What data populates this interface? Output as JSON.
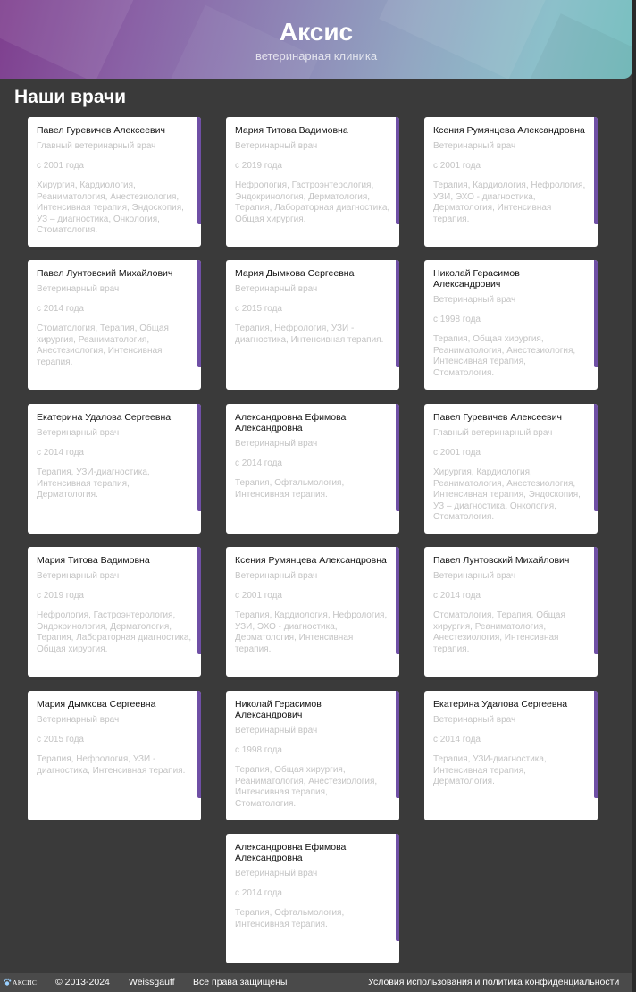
{
  "header": {
    "title": "Аксис",
    "subtitle": "ветеринарная клиника"
  },
  "section_title": "Наши врачи",
  "doctors": [
    {
      "name": "Павел Гуревичев Алексеевич",
      "role": "Главный ветеринарный врач",
      "since": "с 2001 года",
      "specs": "Хирургия, Кардиология, Реаниматология, Анестезиология, Интенсивная терапия, Эндоскопия, УЗ – диагностика, Онкология, Стоматология."
    },
    {
      "name": "Мария Титова Вадимовна",
      "role": "Ветеринарный врач",
      "since": "с 2019 года",
      "specs": "Нефрология, Гастроэнтерология, Эндокринология, Дерматология, Терапия, Лабораторная диагностика, Общая хирургия."
    },
    {
      "name": "Ксения Румянцева Александровна",
      "role": "Ветеринарный врач",
      "since": "с 2001 года",
      "specs": "Терапия, Кардиология, Нефрология, УЗИ, ЭХО - диагностика, Дерматология, Интенсивная терапия."
    },
    {
      "name": "Павел Лунтовский Михайлович",
      "role": "Ветеринарный врач",
      "since": "с 2014 года",
      "specs": "Стоматология, Терапия, Общая хирургия, Реаниматология, Анестезиология, Интенсивная терапия."
    },
    {
      "name": "Мария Дымкова Сергеевна",
      "role": "Ветеринарный врач",
      "since": "с 2015 года",
      "specs": "Терапия, Нефрология, УЗИ - диагностика, Интенсивная терапия."
    },
    {
      "name": "Николай Герасимов Александрович",
      "role": "Ветеринарный врач",
      "since": "с 1998 года",
      "specs": "Терапия, Общая хирургия, Реаниматология, Анестезиология, Интенсивная терапия, Стоматология."
    },
    {
      "name": "Екатерина Удалова Сергеевна",
      "role": "Ветеринарный врач",
      "since": "с 2014 года",
      "specs": "Терапия, УЗИ-диагностика, Интенсивная терапия, Дерматология."
    },
    {
      "name": "Александровна Ефимова Александровна",
      "role": "Ветеринарный врач",
      "since": "с 2014 года",
      "specs": "Терапия, Офтальмология, Интенсивная терапия."
    },
    {
      "name": "Павел Гуревичев Алексеевич",
      "role": "Главный ветеринарный врач",
      "since": "с 2001 года",
      "specs": "Хирургия, Кардиология, Реаниматология, Анестезиология, Интенсивная терапия, Эндоскопия, УЗ – диагностика, Онкология, Стоматология."
    },
    {
      "name": "Мария Титова Вадимовна",
      "role": "Ветеринарный врач",
      "since": "с 2019 года",
      "specs": "Нефрология, Гастроэнтерология, Эндокринология, Дерматология, Терапия, Лабораторная диагностика, Общая хирургия."
    },
    {
      "name": "Ксения Румянцева Александровна",
      "role": "Ветеринарный врач",
      "since": "с 2001 года",
      "specs": "Терапия, Кардиология, Нефрология, УЗИ, ЭХО - диагностика, Дерматология, Интенсивная терапия."
    },
    {
      "name": "Павел Лунтовский Михайлович",
      "role": "Ветеринарный врач",
      "since": "с 2014 года",
      "specs": "Стоматология, Терапия, Общая хирургия, Реаниматология, Анестезиология, Интенсивная терапия."
    },
    {
      "name": "Мария Дымкова Сергеевна",
      "role": "Ветеринарный врач",
      "since": "с 2015 года",
      "specs": "Терапия, Нефрология, УЗИ - диагностика, Интенсивная терапия."
    },
    {
      "name": "Николай Герасимов Александрович",
      "role": "Ветеринарный врач",
      "since": "с 1998 года",
      "specs": "Терапия, Общая хирургия, Реаниматология, Анестезиология, Интенсивная терапия, Стоматология."
    },
    {
      "name": "Екатерина Удалова Сергеевна",
      "role": "Ветеринарный врач",
      "since": "с 2014 года",
      "specs": "Терапия, УЗИ-диагностика, Интенсивная терапия, Дерматология."
    },
    {
      "name": "Александровна Ефимова Александровна",
      "role": "Ветеринарный врач",
      "since": "с 2014 года",
      "specs": "Терапия, Офтальмология, Интенсивная терапия."
    }
  ],
  "footer": {
    "logo_text": "АКСИС",
    "copyright": "© 2013-2024",
    "developer": "Weissgauff",
    "rights": "Все права защищены",
    "terms_link": "Условия использования и политика конфиденциальности"
  },
  "colors": {
    "accent": "#6f4fa5",
    "background": "#3a3a3a",
    "card": "#ffffff",
    "muted_text": "#c4c4c4"
  },
  "icons": {
    "footer_logo": "paw-logo-icon"
  }
}
